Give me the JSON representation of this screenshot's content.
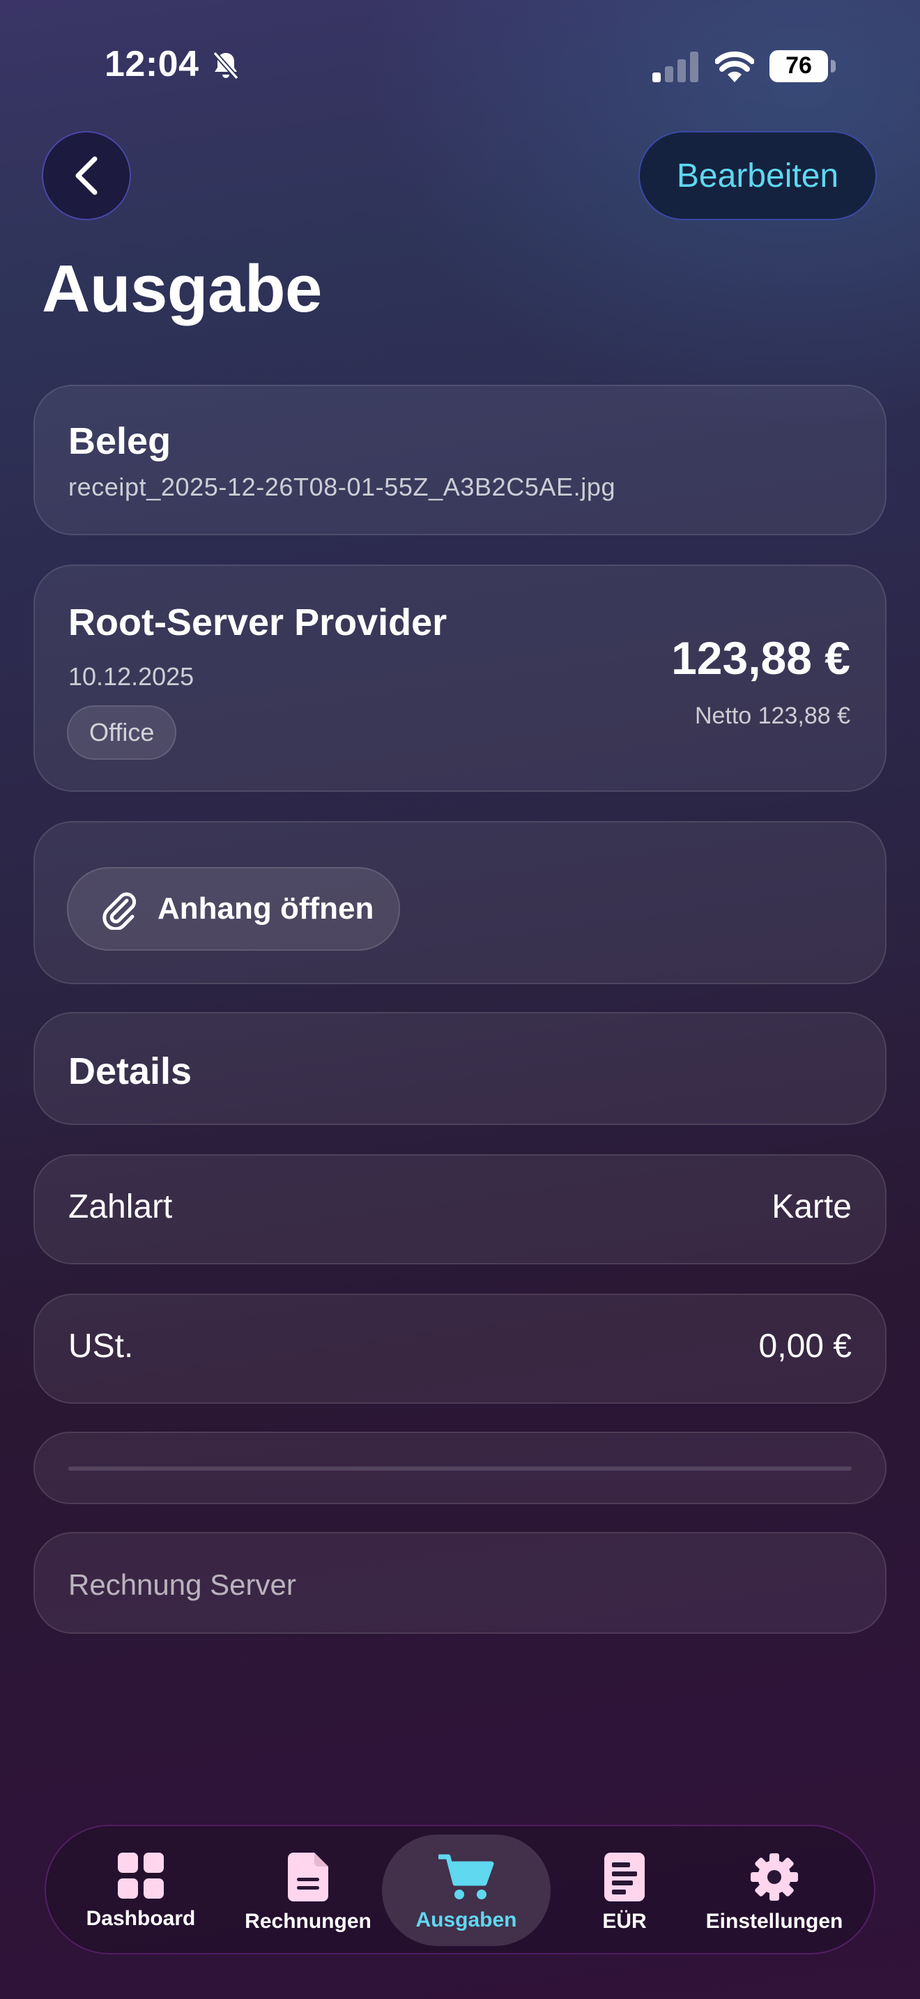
{
  "status_bar": {
    "time": "12:04",
    "battery": "76"
  },
  "header": {
    "edit_label": "Bearbeiten",
    "title": "Ausgabe"
  },
  "receipt": {
    "title": "Beleg",
    "filename": "receipt_2025-12-26T08-01-55Z_A3B2C5AE.jpg"
  },
  "expense": {
    "vendor": "Root-Server Provider",
    "date": "10.12.2025",
    "category": "Office",
    "amount": "123,88 €",
    "netto": "Netto 123,88 €"
  },
  "attachment": {
    "button_label": "Anhang öffnen"
  },
  "details": {
    "title": "Details",
    "rows": [
      {
        "label": "Zahlart",
        "value": "Karte"
      },
      {
        "label": "USt.",
        "value": "0,00 €"
      }
    ],
    "note": "Rechnung Server"
  },
  "tabbar": {
    "items": [
      {
        "label": "Dashboard",
        "icon": "grid-icon"
      },
      {
        "label": "Rechnungen",
        "icon": "document-icon"
      },
      {
        "label": "Ausgaben",
        "icon": "cart-icon"
      },
      {
        "label": "EÜR",
        "icon": "report-icon"
      },
      {
        "label": "Einstellungen",
        "icon": "gear-icon"
      }
    ],
    "active": "Ausgaben"
  },
  "colors": {
    "accent": "#5fd8f0",
    "tab_icon": "#ffd6ee"
  }
}
